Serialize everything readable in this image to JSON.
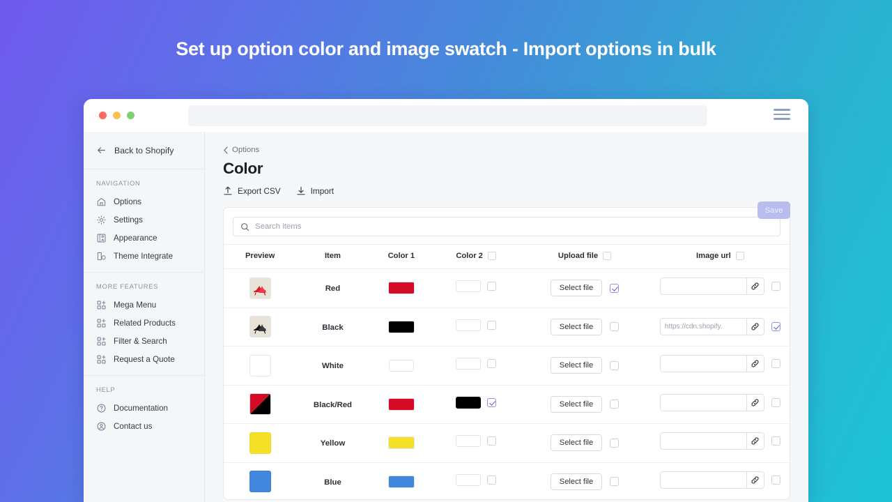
{
  "banner": {
    "title": "Set up option color and image swatch - Import options in bulk"
  },
  "browser": {
    "dots": [
      "close-red",
      "minimize-yellow",
      "maximize-green"
    ],
    "url_value": "",
    "menu_icon": "hamburger-icon"
  },
  "sidebar": {
    "back": {
      "label": "Back to Shopify",
      "icon": "arrow-left-icon"
    },
    "sections": [
      {
        "title": "NAVIGATION",
        "items": [
          {
            "label": "Options",
            "icon": "home-icon"
          },
          {
            "label": "Settings",
            "icon": "gear-icon"
          },
          {
            "label": "Appearance",
            "icon": "appearance-icon"
          },
          {
            "label": "Theme Integrate",
            "icon": "tag-icon"
          }
        ]
      },
      {
        "title": "MORE FEATURES",
        "items": [
          {
            "label": "Mega Menu",
            "icon": "grid-plus-icon"
          },
          {
            "label": "Related Products",
            "icon": "grid-plus-icon"
          },
          {
            "label": "Filter & Search",
            "icon": "grid-plus-icon"
          },
          {
            "label": "Request a Quote",
            "icon": "grid-plus-icon"
          }
        ]
      },
      {
        "title": "HELP",
        "items": [
          {
            "label": "Documentation",
            "icon": "question-circle-icon"
          },
          {
            "label": "Contact us",
            "icon": "user-circle-icon"
          }
        ]
      }
    ]
  },
  "main": {
    "breadcrumb": "Options",
    "page_title": "Color",
    "actions": [
      {
        "label": "Export CSV",
        "icon": "upload-icon"
      },
      {
        "label": "Import",
        "icon": "download-icon"
      }
    ],
    "save_label": "Save",
    "search": {
      "placeholder": "Search items",
      "value": "",
      "icon": "search-icon"
    }
  },
  "table": {
    "columns": [
      {
        "label": "Preview",
        "has_checkbox": false
      },
      {
        "label": "Item",
        "has_checkbox": false
      },
      {
        "label": "Color 1",
        "has_checkbox": false
      },
      {
        "label": "Color 2",
        "has_checkbox": true
      },
      {
        "label": "Upload file",
        "has_checkbox": true
      },
      {
        "label": "Image url",
        "has_checkbox": true
      }
    ],
    "select_file_label": "Select file",
    "rows": [
      {
        "item": "Red",
        "preview_type": "photo-red-heels",
        "color1": "#d50a25",
        "color2": "",
        "color2_checked": false,
        "upload_checked": true,
        "url_value": "",
        "url_checked": false
      },
      {
        "item": "Black",
        "preview_type": "photo-black-heels",
        "color1": "#000000",
        "color2": "",
        "color2_checked": false,
        "upload_checked": false,
        "url_value": "https://cdn.shopify.",
        "url_checked": true
      },
      {
        "item": "White",
        "preview_type": "swatch-white",
        "color1": "",
        "color2": "",
        "color2_checked": false,
        "upload_checked": false,
        "url_value": "",
        "url_checked": false
      },
      {
        "item": "Black/Red",
        "preview_type": "swatch-split-red-black",
        "color1": "#d50a25",
        "color2": "#000000",
        "color2_checked": true,
        "upload_checked": false,
        "url_value": "",
        "url_checked": false
      },
      {
        "item": "Yellow",
        "preview_type": "swatch-yellow",
        "color1": "#f5e029",
        "color2": "",
        "color2_checked": false,
        "upload_checked": false,
        "url_value": "",
        "url_checked": false
      },
      {
        "item": "Blue",
        "preview_type": "swatch-blue",
        "color1": "#4187dd",
        "color2": "",
        "color2_checked": false,
        "upload_checked": false,
        "url_value": "",
        "url_checked": false
      }
    ]
  },
  "colors": {
    "gradient_start": "#7059ee",
    "gradient_end": "#1cc3d6",
    "save_disabled": "#b8bdee",
    "sidebar_bg": "#f4f6f8",
    "main_bg": "#f6f7f9"
  }
}
